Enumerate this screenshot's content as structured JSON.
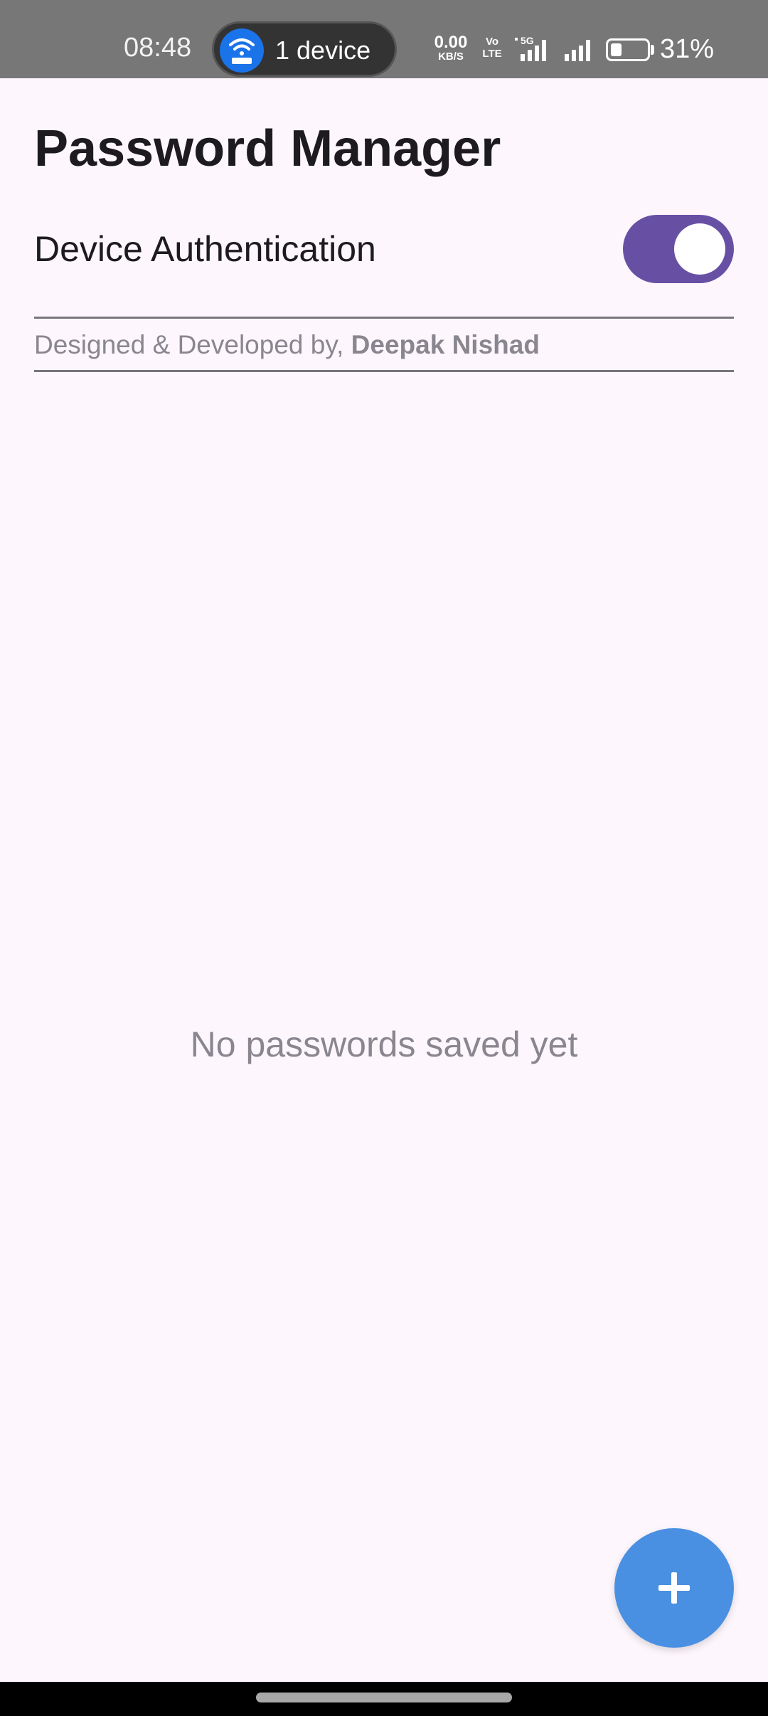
{
  "status_bar": {
    "time": "08:48",
    "hotspot": {
      "label": "1 device",
      "icon": "hotspot-icon"
    },
    "net_speed": {
      "value": "0.00",
      "unit": "KB/S"
    },
    "volte": {
      "top": "Vo",
      "bottom": "LTE"
    },
    "network": "5G",
    "battery": {
      "percent_text": "31%",
      "level": 0.31
    }
  },
  "header": {
    "title": "Password Manager"
  },
  "settings": {
    "device_auth_label": "Device Authentication",
    "device_auth_enabled": true,
    "toggle_color": "#6750a4"
  },
  "credit": {
    "prefix": "Designed & Developed by,",
    "author": "Deepak Nishad"
  },
  "empty_state": {
    "message": "No passwords saved yet"
  },
  "fab": {
    "icon": "plus-icon",
    "color": "#4a90e2"
  }
}
